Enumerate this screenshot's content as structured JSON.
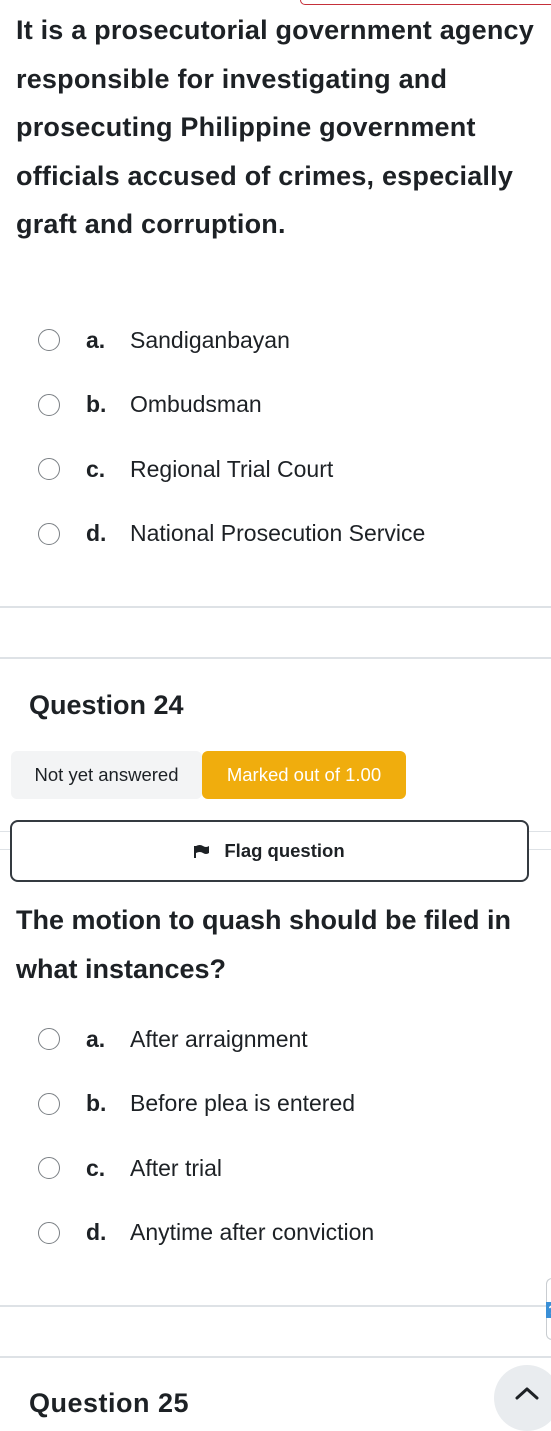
{
  "previous_question": {
    "text": "It is a prosecutorial government agency responsible for investigating and prosecuting Philippine government officials accused of crimes, especially graft and corruption.",
    "answers": [
      {
        "letter": "a.",
        "text": "Sandiganbayan"
      },
      {
        "letter": "b.",
        "text": "Ombudsman"
      },
      {
        "letter": "c.",
        "text": "Regional Trial Court"
      },
      {
        "letter": "d.",
        "text": "National Prosecution Service"
      }
    ]
  },
  "question": {
    "header": "Question 24",
    "status": "Not yet answered",
    "marks": "Marked out of 1.00",
    "flag_label": "Flag question",
    "text": "The motion to quash should be filed in what instances?",
    "answers": [
      {
        "letter": "a.",
        "text": "After arraignment"
      },
      {
        "letter": "b.",
        "text": "Before plea is entered"
      },
      {
        "letter": "c.",
        "text": "After trial"
      },
      {
        "letter": "d.",
        "text": "Anytime after conviction"
      }
    ]
  },
  "next_question": {
    "header": "Question 25"
  },
  "side_tab": {
    "icon": "?"
  },
  "colors": {
    "marks_badge": "#f0ad0d",
    "status_badge": "#f3f4f5",
    "accent": "#c5303a"
  }
}
